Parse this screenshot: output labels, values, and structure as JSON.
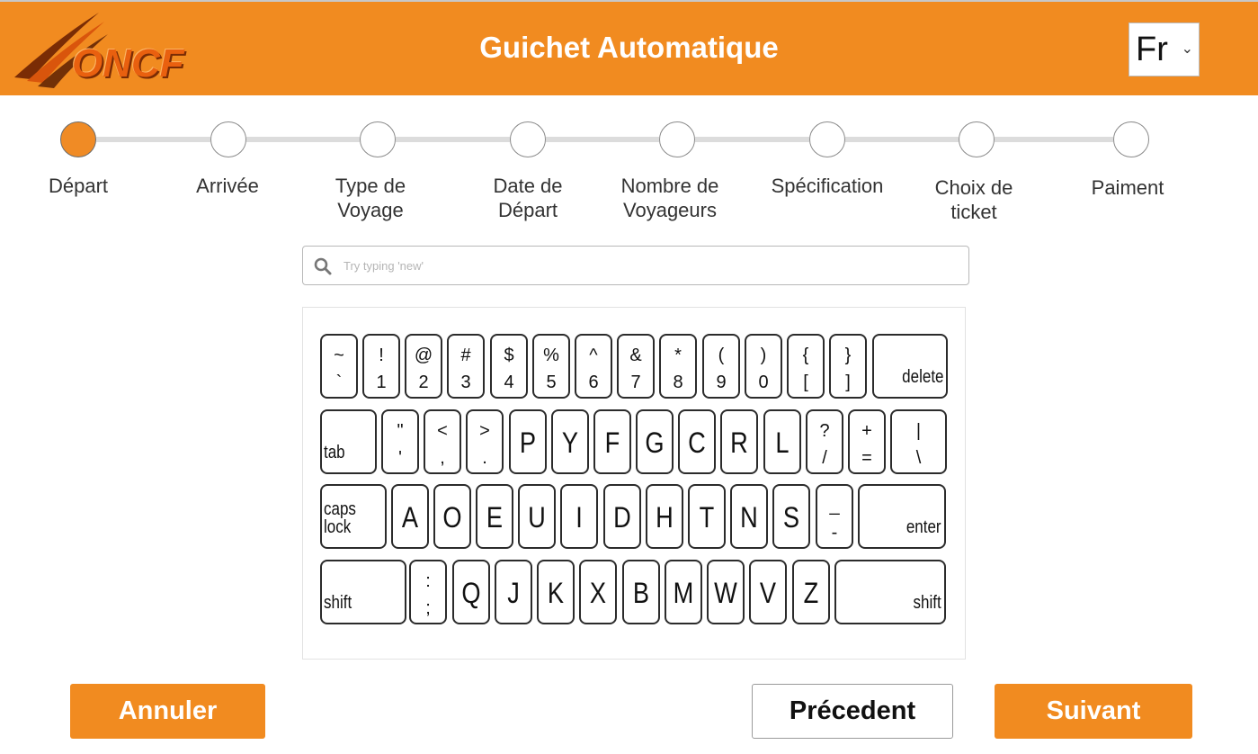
{
  "header": {
    "logo_text": "ONCF",
    "title": "Guichet Automatique",
    "language": "Fr"
  },
  "colors": {
    "brand": "#f18b20",
    "active_step": "#f08b25"
  },
  "steps": [
    {
      "label_line1": "Départ",
      "label_line2": "",
      "active": true
    },
    {
      "label_line1": "Arrivée",
      "label_line2": "",
      "active": false
    },
    {
      "label_line1": "Type de",
      "label_line2": "Voyage",
      "active": false
    },
    {
      "label_line1": "Date de",
      "label_line2": "Départ",
      "active": false
    },
    {
      "label_line1": "Nombre de",
      "label_line2": "Voyageurs",
      "active": false
    },
    {
      "label_line1": "Spécification",
      "label_line2": "",
      "active": false
    },
    {
      "label_line1": "Choix de",
      "label_line2": "ticket",
      "active": false
    },
    {
      "label_line1": "Paiment",
      "label_line2": "",
      "active": false
    }
  ],
  "search": {
    "placeholder": "Try typing 'new'",
    "icon": "search-icon"
  },
  "keyboard": {
    "layout": "dvorak",
    "rows": [
      [
        {
          "top": "~",
          "bottom": "`"
        },
        {
          "top": "!",
          "bottom": "1"
        },
        {
          "top": "@",
          "bottom": "2"
        },
        {
          "top": "#",
          "bottom": "3"
        },
        {
          "top": "$",
          "bottom": "4"
        },
        {
          "top": "%",
          "bottom": "5"
        },
        {
          "top": "^",
          "bottom": "6"
        },
        {
          "top": "&",
          "bottom": "7"
        },
        {
          "top": "*",
          "bottom": "8"
        },
        {
          "top": "(",
          "bottom": "9"
        },
        {
          "top": ")",
          "bottom": "0"
        },
        {
          "top": "{",
          "bottom": "["
        },
        {
          "top": "}",
          "bottom": "]"
        },
        {
          "word": "delete"
        }
      ],
      [
        {
          "word": "tab"
        },
        {
          "top": "\"",
          "bottom": "'"
        },
        {
          "top": "<",
          "bottom": ","
        },
        {
          "top": ">",
          "bottom": "."
        },
        {
          "char": "P"
        },
        {
          "char": "Y"
        },
        {
          "char": "F"
        },
        {
          "char": "G"
        },
        {
          "char": "C"
        },
        {
          "char": "R"
        },
        {
          "char": "L"
        },
        {
          "top": "?",
          "bottom": "/"
        },
        {
          "top": "+",
          "bottom": "="
        },
        {
          "top": "|",
          "bottom": "\\"
        }
      ],
      [
        {
          "word": "caps lock"
        },
        {
          "char": "A"
        },
        {
          "char": "O"
        },
        {
          "char": "E"
        },
        {
          "char": "U"
        },
        {
          "char": "I"
        },
        {
          "char": "D"
        },
        {
          "char": "H"
        },
        {
          "char": "T"
        },
        {
          "char": "N"
        },
        {
          "char": "S"
        },
        {
          "top": "_",
          "bottom": "-"
        },
        {
          "word": "enter"
        }
      ],
      [
        {
          "word": "shift"
        },
        {
          "top": ":",
          "bottom": ";"
        },
        {
          "char": "Q"
        },
        {
          "char": "J"
        },
        {
          "char": "K"
        },
        {
          "char": "X"
        },
        {
          "char": "B"
        },
        {
          "char": "M"
        },
        {
          "char": "W"
        },
        {
          "char": "V"
        },
        {
          "char": "Z"
        },
        {
          "word": "shift"
        }
      ]
    ]
  },
  "buttons": {
    "cancel": "Annuler",
    "previous": "Précedent",
    "next": "Suivant"
  }
}
